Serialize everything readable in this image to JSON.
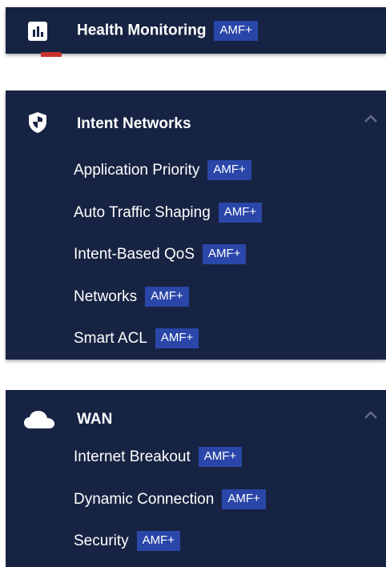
{
  "badge_text": "AMF+",
  "health": {
    "label": "Health Monitoring",
    "icon": "bar-chart-icon"
  },
  "intent": {
    "label": "Intent Networks",
    "icon": "shield-icon",
    "items": [
      {
        "label": "Application Priority"
      },
      {
        "label": "Auto Traffic Shaping"
      },
      {
        "label": "Intent-Based QoS"
      },
      {
        "label": "Networks"
      },
      {
        "label": "Smart ACL"
      }
    ]
  },
  "wan": {
    "label": "WAN",
    "icon": "cloud-icon",
    "items": [
      {
        "label": "Internet Breakout"
      },
      {
        "label": "Dynamic Connection"
      },
      {
        "label": "Security"
      }
    ]
  },
  "colors": {
    "panel_bg": "#172342",
    "badge_bg": "#2a46a8",
    "text": "#ffffff",
    "alert_tab": "#c9332c"
  }
}
